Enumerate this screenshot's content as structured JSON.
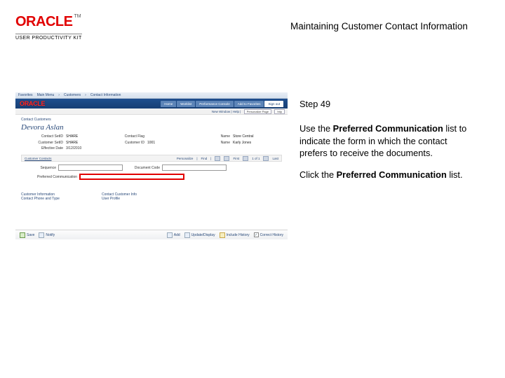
{
  "header": {
    "brand": "ORACLE",
    "tm": "TM",
    "product_line": "USER PRODUCTIVITY KIT",
    "title": "Maintaining Customer Contact Information"
  },
  "instructions": {
    "step_label": "Step 49",
    "para1_lead": "Use the ",
    "para1_bold": "Preferred Communication",
    "para1_tail": " list to indicate the form in which the contact prefers to receive the documents.",
    "para2_lead": "Click the ",
    "para2_bold": "Preferred Communication",
    "para2_tail": " list."
  },
  "shot": {
    "topstrip": {
      "a": "Favorites",
      "b": "Main Menu",
      "c": "Customers",
      "d": "Contact Information"
    },
    "nav": {
      "brand": "ORACLE",
      "tabs": [
        "Home",
        "Worklist",
        "Performance Console",
        "Add to Favorites",
        "Sign out"
      ],
      "active_index": 4
    },
    "subbar": {
      "left": "New Window",
      "mid": "Help",
      "right": "Personalize Page"
    },
    "crumb": "Contact Customers",
    "person_name": "Devora Aslan",
    "details": {
      "r1": {
        "l1": "Contact SetID",
        "v1": "SHARE",
        "l2": "Contact Flag",
        "v2": "",
        "l3": "Name",
        "v3": "Store Central"
      },
      "r2": {
        "l1": "Customer SetID",
        "v1": "SHARE",
        "l2": "Customer ID",
        "v2": "1001",
        "l3": "Name",
        "v3": "Karly Jones"
      },
      "eff_label": "Effective Date",
      "eff_value": "3/12/2010"
    },
    "toolbar": {
      "a": "Customer Contacts",
      "b": "Personalize",
      "c": "Find",
      "d": "First",
      "e": "1 of 1",
      "f": "Last"
    },
    "form": {
      "l1": "Sequence",
      "l2": "Preferred Communication",
      "l3": "Document Code"
    },
    "cols": {
      "h1": "Customer Information",
      "v1": "Contact Phone and Type",
      "h2": "Contact Customer Info",
      "v2": "User Profile"
    },
    "bottom": {
      "save": "Save",
      "notify": "Notify",
      "add": "Add",
      "update": "Update/Display",
      "history": "Include History",
      "correct": "Correct History"
    }
  }
}
